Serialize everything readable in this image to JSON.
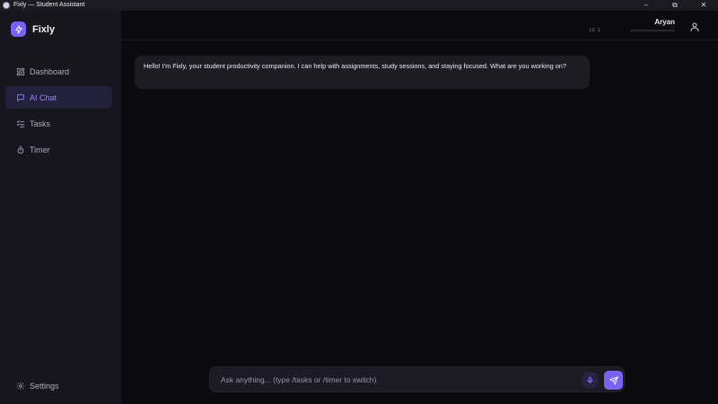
{
  "window": {
    "title": "Fixly — Student Assistant",
    "controls": {
      "minimize": "–",
      "restore": "⧉",
      "close": "✕"
    }
  },
  "brand": {
    "name": "Fixly",
    "icon": "lightning-bolt-icon",
    "color": "#7b61f5"
  },
  "sidebar": {
    "items": [
      {
        "label": "Dashboard",
        "icon": "dashboard-grid-icon",
        "active": false
      },
      {
        "label": "AI Chat",
        "icon": "chat-bubble-icon",
        "active": true
      },
      {
        "label": "Tasks",
        "icon": "checklist-icon",
        "active": false
      },
      {
        "label": "Timer",
        "icon": "stopwatch-icon",
        "active": false
      }
    ],
    "settings": {
      "label": "Settings",
      "icon": "gear-icon"
    }
  },
  "user": {
    "name": "Aryan",
    "level": "LV. 1",
    "xp_progress": 0.0,
    "icon": "user-icon"
  },
  "chat": {
    "messages": [
      {
        "role": "assistant",
        "text": "Hello! I'm Fixly, your student productivity companion. I can help with assignments, study sessions, and staying focused. What are you working on?"
      }
    ],
    "input": {
      "value": "",
      "placeholder": "Ask anything... (type /tasks or /timer to switch)"
    },
    "mic_icon": "microphone-icon",
    "send_icon": "send-icon"
  },
  "colors": {
    "accent": "#7b61f5",
    "active_nav_text": "#9a86ff",
    "sidebar_bg": "#17161e",
    "main_bg": "#0b0a0f",
    "bubble_bg": "#1d1c25"
  }
}
